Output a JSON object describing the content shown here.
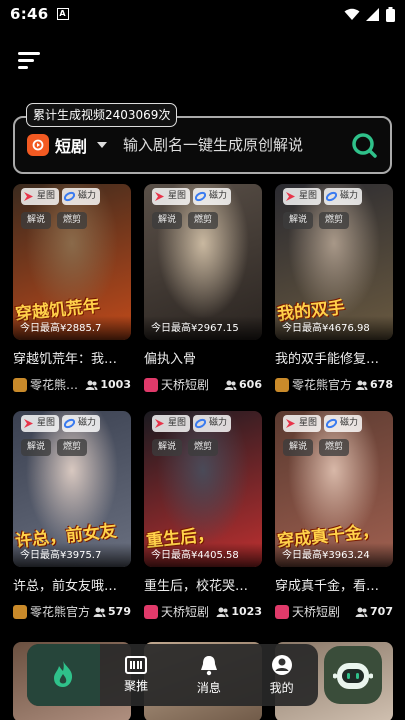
{
  "status_bar": {
    "time": "6:46",
    "notification_letter": "A"
  },
  "tooltip": {
    "text": "累计生成视频2403069次"
  },
  "search": {
    "source_label": "短剧",
    "placeholder": "输入剧名一键生成原创解说"
  },
  "badges": {
    "platform_a": "星图",
    "platform_b": "磁力",
    "tag_a": "解说",
    "tag_b": "燃剪"
  },
  "cards": [
    {
      "poster_text": "穿越饥荒年",
      "peak": "今日最高¥2885.7",
      "title": "穿越饥荒年：我…",
      "creator": "零花熊…",
      "users": "1003",
      "creator_color": "#c98a2a",
      "art": [
        "#3a2a1e",
        "#8a6a4a",
        "#c24a1a"
      ]
    },
    {
      "poster_text": "",
      "peak": "今日最高¥2967.15",
      "title": "偏执入骨",
      "creator": "天桥短剧",
      "users": "606",
      "creator_color": "#e03a6a",
      "art": [
        "#5a5048",
        "#c9b8a0",
        "#2a2420"
      ]
    },
    {
      "poster_text": "我的双手",
      "peak": "今日最高¥4676.98",
      "title": "我的双手能修复…",
      "creator": "零花熊官方",
      "users": "678",
      "creator_color": "#c98a2a",
      "art": [
        "#2a2a30",
        "#a89888",
        "#6a5a40"
      ]
    },
    {
      "poster_text": "许总，前女友",
      "peak": "今日最高¥3975.7",
      "title": "许总，前女友哦…",
      "creator": "零花熊官方",
      "users": "579",
      "creator_color": "#c98a2a",
      "art": [
        "#3a4050",
        "#d8c8c0",
        "#6a7080"
      ]
    },
    {
      "poster_text": "重生后，",
      "peak": "今日最高¥4405.58",
      "title": "重生后，校花哭…",
      "creator": "天桥短剧",
      "users": "1023",
      "creator_color": "#e03a6a",
      "art": [
        "#1a1a20",
        "#4a4a58",
        "#c03030"
      ]
    },
    {
      "poster_text": "穿成真千金，",
      "peak": "今日最高¥3963.24",
      "title": "穿成真千金，看…",
      "creator": "天桥短剧",
      "users": "707",
      "creator_color": "#e03a6a",
      "art": [
        "#5a3a30",
        "#d8b8a8",
        "#a06050"
      ]
    }
  ],
  "nav": [
    {
      "label": "",
      "icon": "flame-icon"
    },
    {
      "label": "聚推",
      "icon": "equalizer-icon"
    },
    {
      "label": "消息",
      "icon": "bell-icon"
    },
    {
      "label": "我的",
      "icon": "person-icon"
    }
  ],
  "colors": {
    "accent": "#2fc18a",
    "search_logo": "#f35a22"
  }
}
